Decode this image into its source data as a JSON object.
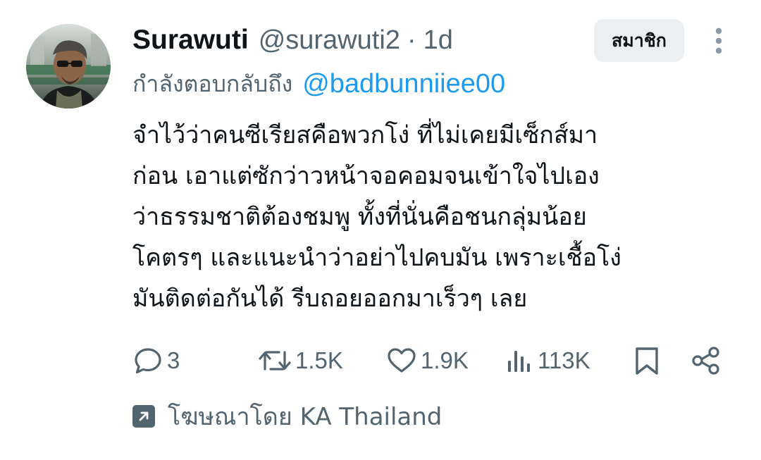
{
  "tweet": {
    "author": {
      "display_name": "Surawuti",
      "handle": "@surawuti2",
      "separator": "·",
      "time": "1d"
    },
    "subscribe_label": "สมาชิก",
    "more_icon": "more-vertical-icon",
    "reply": {
      "prefix": "กำลังตอบกลับถึง",
      "mention": "@badbunniiee00"
    },
    "text_lines": [
      "จำไว้ว่าคนซีเรียสคือพวกโง่ ที่ไม่เคยมีเซ็กส์มา",
      "ก่อน เอาแต่ซักว่าวหน้าจอคอมจนเข้าใจไปเอง",
      "ว่าธรรมชาติต้องชมพู ทั้งที่นั่นคือชนกลุ่มน้อย",
      "โคตรๆ และแนะนำว่าอย่าไปคบมัน เพราะเชื้อโง่",
      "มันติดต่อกันได้ รีบถอยออกมาเร็วๆ เลย"
    ],
    "actions": {
      "replies": "3",
      "reposts": "1.5K",
      "likes": "1.9K",
      "views": "113K"
    },
    "promoted": "โฆษณาโดย KA Thailand"
  },
  "colors": {
    "text": "#0f1419",
    "secondary": "#536471",
    "link": "#1d9bf0",
    "subscribe_bg": "#eceff1"
  }
}
